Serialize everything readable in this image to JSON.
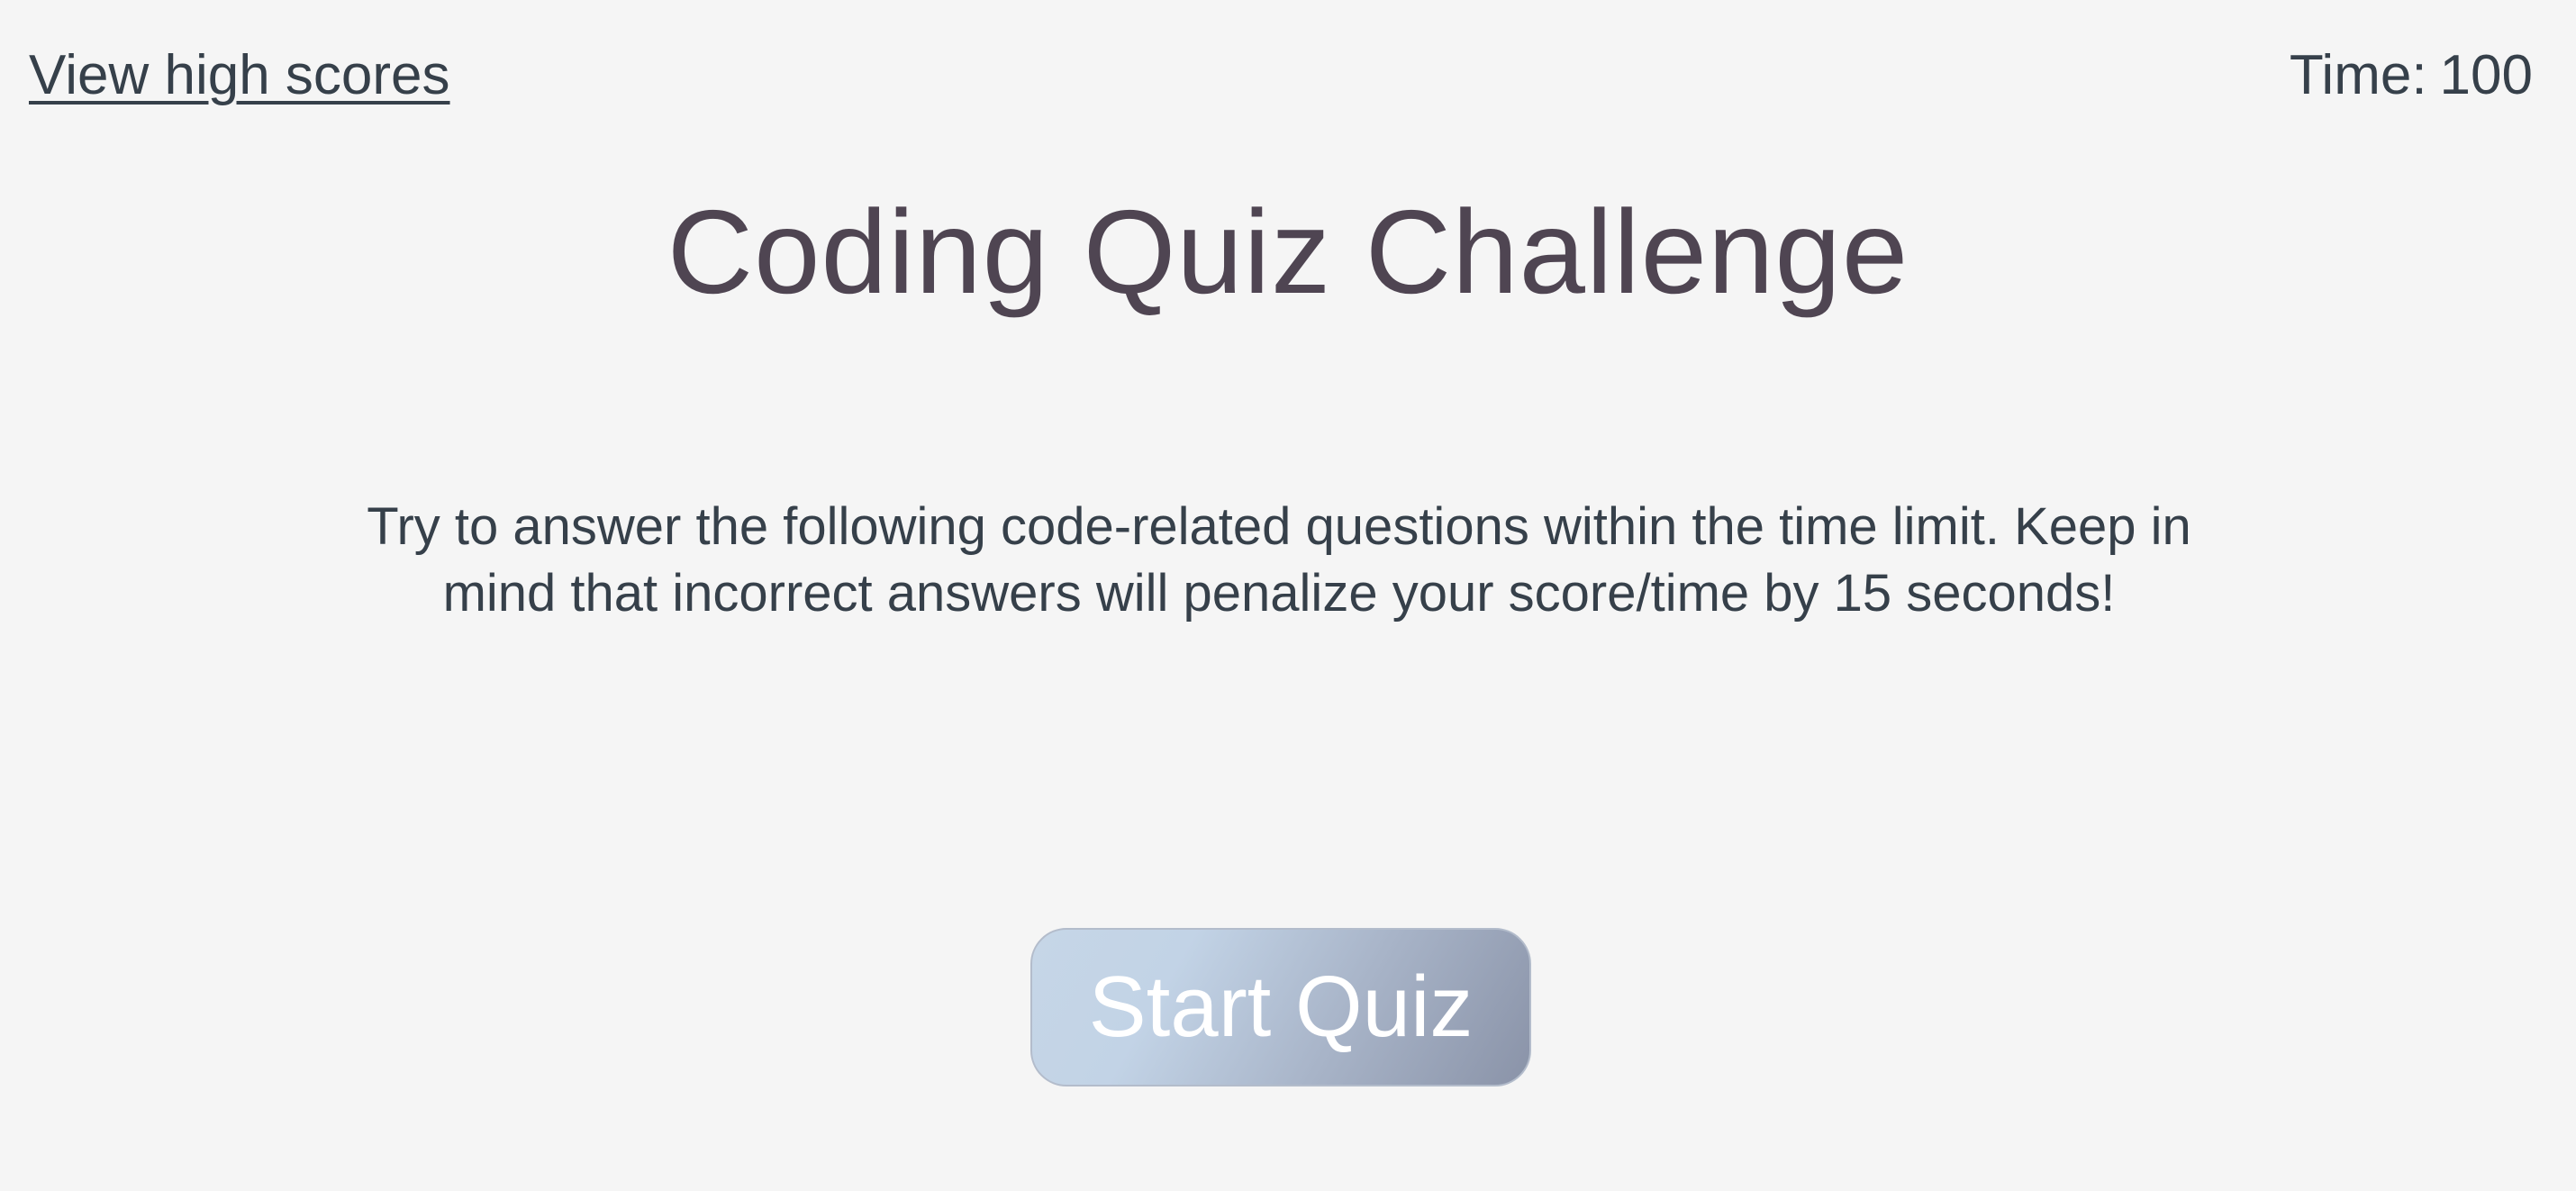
{
  "header": {
    "high_scores_link": "View high scores",
    "timer_label": "Time:",
    "timer_value": "100"
  },
  "main": {
    "title": "Coding Quiz Challenge",
    "description": "Try to answer the following code-related questions within the time limit. Keep in mind that incorrect answers will penalize your score/time by 15 seconds!",
    "start_button_label": "Start Quiz"
  },
  "colors": {
    "background": "#f5f5f5",
    "text": "#36404a",
    "title": "#4f4552",
    "button_gradient_start": "#c6d6e7",
    "button_gradient_end": "#8a93a8",
    "button_text": "#ffffff"
  }
}
